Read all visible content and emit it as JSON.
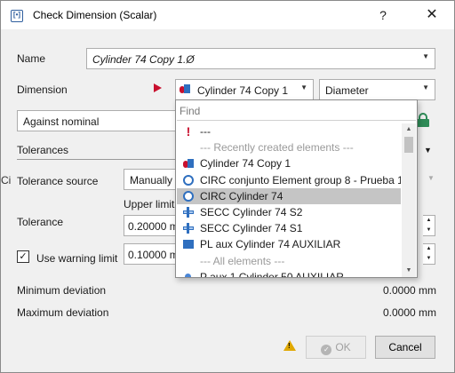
{
  "window": {
    "title": "Check Dimension (Scalar)",
    "help_label": "?",
    "close_label": "✕"
  },
  "form": {
    "name_label": "Name",
    "name_value": "Cylinder 74 Copy 1.Ø",
    "dimension_label": "Dimension",
    "dimension_element": "Cylinder 74 Copy 1",
    "dimension_type": "Diameter",
    "against_value": "Against nominal",
    "tolerances_title": "Tolerances",
    "tolerance_source_label": "Tolerance source",
    "tolerance_source_value": "Manually",
    "upper_limit_label": "Upper limit",
    "tolerance_label": "Tolerance",
    "tolerance_value": "0.20000 m",
    "use_warning_limit_label": "Use warning limit",
    "use_warning_limit_checked": true,
    "warning_value": "0.10000 m",
    "minimum_deviation_label": "Minimum deviation",
    "minimum_deviation_value": "0.0000 mm",
    "maximum_deviation_label": "Maximum deviation",
    "maximum_deviation_value": "0.0000 mm",
    "left_edge_fragment": "Ci"
  },
  "buttons": {
    "ok_label": "OK",
    "cancel_label": "Cancel"
  },
  "dropdown": {
    "find_placeholder": "Find",
    "items": [
      {
        "label": "---",
        "icon": "exclamation-icon",
        "kind": "item"
      },
      {
        "label": "--- Recently created elements ---",
        "icon": "",
        "kind": "header"
      },
      {
        "label": "Cylinder 74 Copy 1",
        "icon": "cylinder-icon",
        "kind": "item"
      },
      {
        "label": "CIRC conjunto Element group 8 - Prueba 1",
        "icon": "circle-icon",
        "kind": "item"
      },
      {
        "label": "CIRC Cylinder 74",
        "icon": "circle-icon",
        "kind": "item",
        "selected": true
      },
      {
        "label": "SECC Cylinder 74 S2",
        "icon": "section-icon",
        "kind": "item"
      },
      {
        "label": "SECC Cylinder 74 S1",
        "icon": "section-icon",
        "kind": "item"
      },
      {
        "label": "PL aux Cylinder 74 AUXILIAR",
        "icon": "plane-icon",
        "kind": "item"
      },
      {
        "label": "--- All elements ---",
        "icon": "",
        "kind": "header"
      },
      {
        "label": "P aux 1 Cylinder 50 AUXILIAR",
        "icon": "point-icon",
        "kind": "item"
      }
    ]
  },
  "colors": {
    "accent_blue": "#2f6fbf",
    "accent_red": "#c8102e",
    "selected_row": "#c5c5c5",
    "lock_green": "#2e8b57",
    "warning_yellow": "#e0a800"
  }
}
